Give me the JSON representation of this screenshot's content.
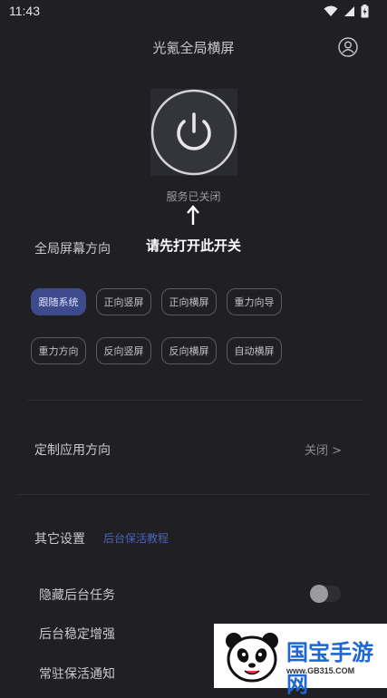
{
  "status_bar": {
    "time": "11:43"
  },
  "header": {
    "title": "光氪全局横屏"
  },
  "power": {
    "status": "服务已关闭",
    "hint": "请先打开此开关"
  },
  "orientation": {
    "title": "全局屏幕方向",
    "selected_index": 0,
    "options": [
      "跟随系统",
      "正向竖屏",
      "正向横屏",
      "重力向导",
      "重力方向",
      "反向竖屏",
      "反向横屏",
      "自动横屏"
    ]
  },
  "app_orientation": {
    "label": "定制应用方向",
    "value": "关闭 >"
  },
  "other_settings": {
    "title": "其它设置",
    "link": "后台保活教程",
    "items": [
      {
        "label": "隐藏后台任务",
        "enabled": false
      },
      {
        "label": "后台稳定增强",
        "enabled": false
      },
      {
        "label": "常驻保活通知",
        "enabled": false
      }
    ]
  },
  "watermark": {
    "text": "国宝手游网",
    "url": "www.GB315.COM"
  },
  "colors": {
    "background": "#1f1f24",
    "accent": "#3d4a8c",
    "link": "#4c64b8"
  }
}
